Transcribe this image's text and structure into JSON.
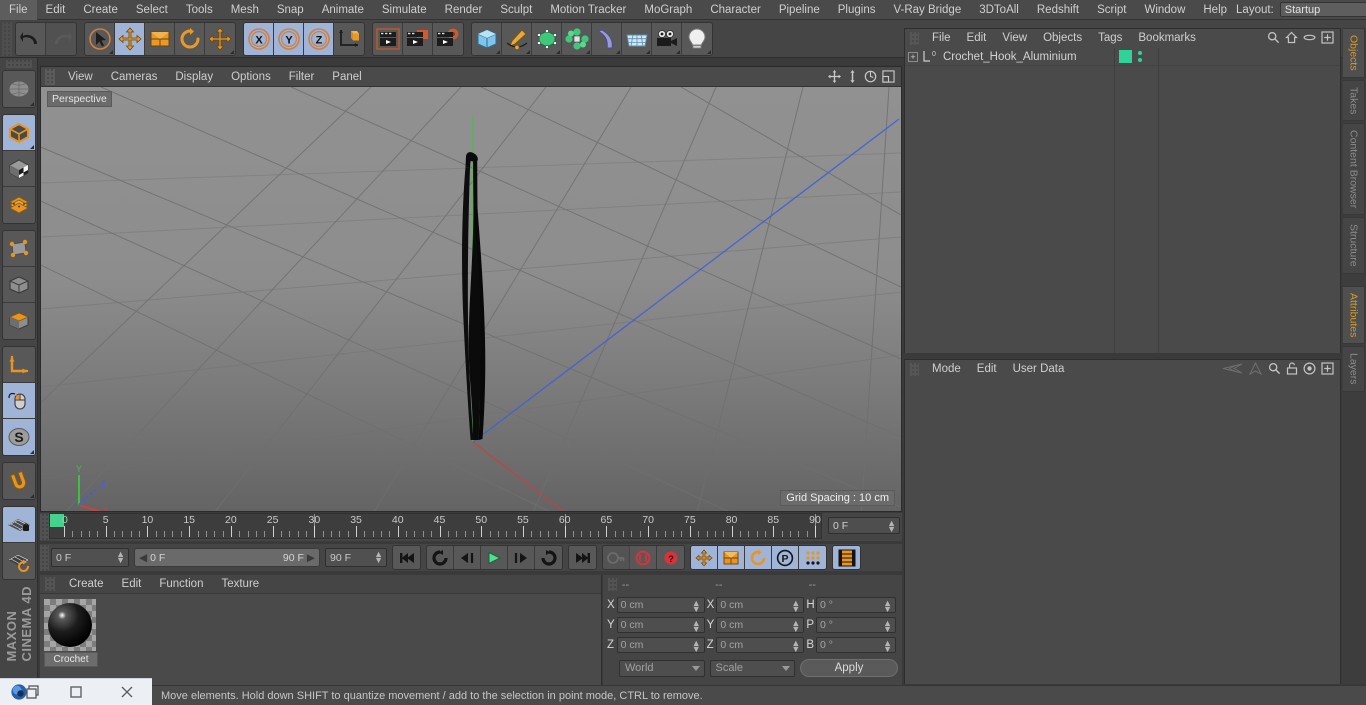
{
  "app": {
    "brand_line1": "MAXON",
    "brand_line2": "CINEMA 4D"
  },
  "menubar": {
    "items": [
      {
        "label": "File"
      },
      {
        "label": "Edit"
      },
      {
        "label": "Create"
      },
      {
        "label": "Select"
      },
      {
        "label": "Tools"
      },
      {
        "label": "Mesh"
      },
      {
        "label": "Snap"
      },
      {
        "label": "Animate"
      },
      {
        "label": "Simulate"
      },
      {
        "label": "Render"
      },
      {
        "label": "Sculpt"
      },
      {
        "label": "Motion Tracker"
      },
      {
        "label": "MoGraph"
      },
      {
        "label": "Character"
      },
      {
        "label": "Pipeline"
      },
      {
        "label": "Plugins"
      },
      {
        "label": "V-Ray Bridge"
      },
      {
        "label": "3DToAll"
      },
      {
        "label": "Redshift"
      },
      {
        "label": "Script"
      },
      {
        "label": "Window"
      },
      {
        "label": "Help"
      }
    ],
    "layout_label": "Layout:",
    "layout_value": "Startup",
    "search_icon": "magnifier-icon"
  },
  "toolbar": {
    "groups": [
      {
        "name": "history",
        "buttons": [
          {
            "icon": "undo-icon",
            "active": false,
            "dim": false
          },
          {
            "icon": "redo-icon",
            "active": false,
            "dim": true
          }
        ]
      },
      {
        "name": "transform",
        "buttons": [
          {
            "icon": "select-cursor-icon",
            "active": false,
            "dim": false
          },
          {
            "icon": "move-icon",
            "active": true,
            "dim": false
          },
          {
            "icon": "scale-icon",
            "active": false,
            "dim": false
          },
          {
            "icon": "rotate-icon",
            "active": false,
            "dim": false
          },
          {
            "icon": "move-alt-icon",
            "active": false,
            "dim": false
          }
        ]
      },
      {
        "name": "axis-lock",
        "buttons": [
          {
            "icon": "x-axis-icon",
            "active": true,
            "dim": false
          },
          {
            "icon": "y-axis-icon",
            "active": true,
            "dim": false
          },
          {
            "icon": "z-axis-icon",
            "active": true,
            "dim": false
          },
          {
            "icon": "world-coordinate-icon",
            "active": false,
            "dim": false
          }
        ]
      },
      {
        "name": "render",
        "buttons": [
          {
            "icon": "render-view-icon",
            "active": false,
            "dim": false
          },
          {
            "icon": "render-region-icon",
            "active": false,
            "dim": false
          },
          {
            "icon": "render-settings-icon",
            "active": false,
            "dim": false
          }
        ]
      },
      {
        "name": "create",
        "buttons": [
          {
            "icon": "cube-primitive-icon",
            "active": false,
            "dim": false
          },
          {
            "icon": "spline-pen-icon",
            "active": false,
            "dim": false
          },
          {
            "icon": "nurbs-generator-icon",
            "active": false,
            "dim": false
          },
          {
            "icon": "array-modeling-icon",
            "active": false,
            "dim": false
          },
          {
            "icon": "deformer-bend-icon",
            "active": false,
            "dim": false
          },
          {
            "icon": "environment-floor-icon",
            "active": false,
            "dim": false
          },
          {
            "icon": "camera-icon",
            "active": false,
            "dim": false
          },
          {
            "icon": "light-icon",
            "active": false,
            "dim": false
          }
        ]
      }
    ]
  },
  "left_toolbar": {
    "groups": [
      {
        "buttons": [
          {
            "icon": "live-selection-icon",
            "active": false
          }
        ]
      },
      {
        "buttons": [
          {
            "icon": "make-editable-icon",
            "active": true
          },
          {
            "icon": "texture-axis-icon",
            "active": false
          },
          {
            "icon": "enable-axis-icon",
            "active": false
          }
        ]
      },
      {
        "buttons": [
          {
            "icon": "points-mode-icon",
            "active": false
          },
          {
            "icon": "edges-mode-icon",
            "active": false
          },
          {
            "icon": "polygons-mode-icon",
            "active": false
          }
        ]
      },
      {
        "buttons": [
          {
            "icon": "object-axis-icon",
            "active": false
          },
          {
            "icon": "viewport-solo-icon",
            "active": true
          },
          {
            "icon": "workplane-icon",
            "active": true
          }
        ]
      },
      {
        "buttons": [
          {
            "icon": "snap-magnet-icon",
            "active": false
          }
        ]
      },
      {
        "buttons": [
          {
            "icon": "workplane-lock-icon",
            "active": true
          },
          {
            "icon": "workplane-rotate-icon",
            "active": false
          }
        ]
      }
    ]
  },
  "viewport": {
    "menu": [
      {
        "label": "View"
      },
      {
        "label": "Cameras"
      },
      {
        "label": "Display"
      },
      {
        "label": "Options"
      },
      {
        "label": "Filter"
      },
      {
        "label": "Panel"
      }
    ],
    "corner_icons": [
      "pan-icon",
      "dolly-icon",
      "orbit-icon",
      "maximize-icon"
    ],
    "label": "Perspective",
    "grid_spacing": "Grid Spacing : 10 cm",
    "axis_gizmo": {
      "x": "X",
      "y": "Y",
      "z": "Z",
      "x_color": "#d04040",
      "y_color": "#3fc03f",
      "z_color": "#4060d8"
    }
  },
  "timeline": {
    "ticks": [
      {
        "label": "0",
        "value": 0
      },
      {
        "label": "5",
        "value": 5
      },
      {
        "label": "10",
        "value": 10
      },
      {
        "label": "15",
        "value": 15
      },
      {
        "label": "20",
        "value": 20
      },
      {
        "label": "25",
        "value": 25
      },
      {
        "label": "30",
        "value": 30
      },
      {
        "label": "35",
        "value": 35
      },
      {
        "label": "40",
        "value": 40
      },
      {
        "label": "45",
        "value": 45
      },
      {
        "label": "50",
        "value": 50
      },
      {
        "label": "55",
        "value": 55
      },
      {
        "label": "60",
        "value": 60
      },
      {
        "label": "65",
        "value": 65
      },
      {
        "label": "70",
        "value": 70
      },
      {
        "label": "75",
        "value": 75
      },
      {
        "label": "80",
        "value": 80
      },
      {
        "label": "85",
        "value": 85
      },
      {
        "label": "90",
        "value": 90
      }
    ],
    "range_min": 0,
    "range_max": 90,
    "playhead_frame": 0,
    "current_frame_field": "0 F"
  },
  "transport": {
    "current_frame": "0 F",
    "range_start": "0 F",
    "range_end": "90 F",
    "max_frame": "90 F",
    "buttons": [
      {
        "icon": "go-to-start-icon",
        "active": false,
        "dim": false
      },
      {
        "icon": "previous-keyframe-icon",
        "active": false,
        "dim": false
      },
      {
        "icon": "step-back-icon",
        "active": false,
        "dim": false
      },
      {
        "icon": "play-icon",
        "active": false,
        "dim": false
      },
      {
        "icon": "step-forward-icon",
        "active": false,
        "dim": false
      },
      {
        "icon": "next-keyframe-icon",
        "active": false,
        "dim": false
      },
      {
        "icon": "go-to-end-icon",
        "active": false,
        "dim": false
      }
    ],
    "record_buttons": [
      {
        "icon": "autokey-icon",
        "active": false,
        "dim": true
      },
      {
        "icon": "record-active-objects-icon",
        "active": false,
        "dim": false
      },
      {
        "icon": "record-question-icon",
        "active": false,
        "dim": false
      }
    ],
    "key_buttons": [
      {
        "icon": "key-position-icon",
        "active": true
      },
      {
        "icon": "key-scale-icon",
        "active": true
      },
      {
        "icon": "key-rotation-icon",
        "active": true
      },
      {
        "icon": "key-parameter-icon",
        "active": true
      },
      {
        "icon": "key-pla-icon",
        "active": true
      }
    ],
    "timeline_toggle": {
      "icon": "timeline-strip-icon",
      "active": true
    }
  },
  "material_manager": {
    "menu": [
      {
        "label": "Create"
      },
      {
        "label": "Edit"
      },
      {
        "label": "Function"
      },
      {
        "label": "Texture"
      }
    ],
    "materials": [
      {
        "name": "Crochet",
        "preview": "black-glossy-sphere"
      }
    ]
  },
  "coordinate_manager": {
    "headers": [
      "--",
      "--",
      "--"
    ],
    "rows": [
      {
        "pos_label": "X",
        "pos_value": "0 cm",
        "size_label": "X",
        "size_value": "0 cm",
        "rot_label": "H",
        "rot_value": "0 °"
      },
      {
        "pos_label": "Y",
        "pos_value": "0 cm",
        "size_label": "Y",
        "size_value": "0 cm",
        "rot_label": "P",
        "rot_value": "0 °"
      },
      {
        "pos_label": "Z",
        "pos_value": "0 cm",
        "size_label": "Z",
        "size_value": "0 cm",
        "rot_label": "B",
        "rot_value": "0 °"
      }
    ],
    "space_select": "World",
    "mode_select": "Scale",
    "apply_label": "Apply"
  },
  "object_manager": {
    "menu": [
      {
        "label": "File"
      },
      {
        "label": "Edit"
      },
      {
        "label": "View"
      },
      {
        "label": "Objects"
      },
      {
        "label": "Tags"
      },
      {
        "label": "Bookmarks"
      }
    ],
    "icons": [
      "search-icon",
      "home-icon",
      "ellipse-icon",
      "plus-box-icon"
    ],
    "objects": [
      {
        "name": "Crochet_Hook_Aluminium",
        "layer_badge": "0",
        "expandable": true,
        "tag_color": "#2fd39a"
      }
    ]
  },
  "attribute_manager": {
    "menu": [
      {
        "label": "Mode"
      },
      {
        "label": "Edit"
      },
      {
        "label": "User Data"
      }
    ],
    "icons": [
      "nav-back-icon",
      "nav-forward-icon",
      "search-icon",
      "lock-icon",
      "target-icon",
      "plus-box-icon"
    ]
  },
  "right_tabs": {
    "upper": [
      {
        "label": "Objects",
        "active": true
      },
      {
        "label": "Takes",
        "active": false
      },
      {
        "label": "Content Browser",
        "active": false
      },
      {
        "label": "Structure",
        "active": false
      }
    ],
    "lower": [
      {
        "label": "Attributes",
        "active": true
      },
      {
        "label": "Layers",
        "active": false
      }
    ]
  },
  "statusbar": {
    "message": "Move elements. Hold down SHIFT to quantize movement / add to the selection in point mode, CTRL to remove."
  },
  "taskbar": {
    "items": [
      {
        "icon": "app-logo-icon"
      },
      {
        "icon": "restore-window-icon"
      },
      {
        "icon": "maximize-window-icon"
      },
      {
        "icon": "close-window-icon"
      }
    ]
  },
  "colors": {
    "accent_orange": "#d79a2b",
    "selection_blue": "#9fb4d6",
    "tag_green": "#2fd39a",
    "play_green": "#44d28c"
  }
}
